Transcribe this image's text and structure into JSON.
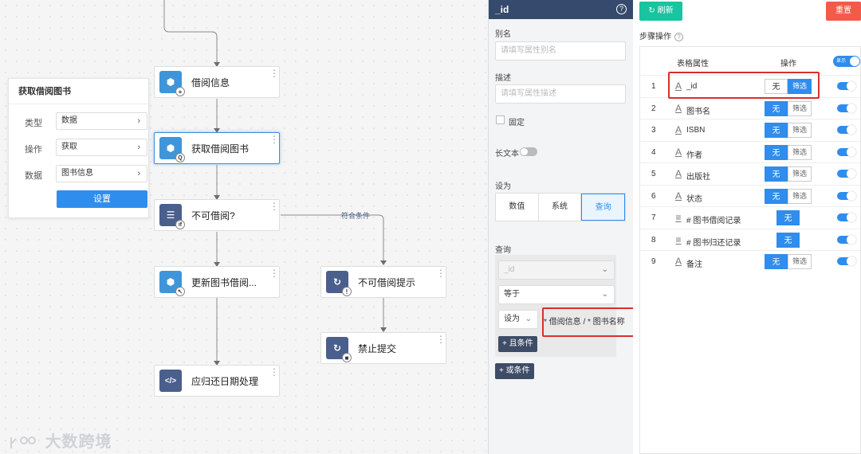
{
  "canvas": {
    "nodes": [
      {
        "label": "借阅信息",
        "icon": "cube-add-icon",
        "badge": "+"
      },
      {
        "label": "获取借阅图书",
        "icon": "cube-search-icon",
        "badge": "🔍"
      },
      {
        "label": "不可借阅?",
        "icon": "condition-if-icon",
        "badge": "if"
      },
      {
        "label": "更新图书借阅...",
        "icon": "cube-update-icon",
        "badge": "↖"
      },
      {
        "label": "不可借阅提示",
        "icon": "loop-alert-icon",
        "badge": "!"
      },
      {
        "label": "禁止提交",
        "icon": "loop-stop-icon",
        "badge": "■"
      },
      {
        "label": "应归还日期处理",
        "icon": "code-icon",
        "badge": "</>"
      }
    ],
    "condition_label": "符合条件"
  },
  "config_card": {
    "title": "获取借阅图书",
    "rows": [
      {
        "label": "类型",
        "value": "数据"
      },
      {
        "label": "操作",
        "value": "获取"
      },
      {
        "label": "数据",
        "value": "图书信息"
      }
    ],
    "button": "设置"
  },
  "watermark": "大数跨境",
  "props": {
    "title": "_id",
    "alias_label": "别名",
    "alias_placeholder": "请填写属性别名",
    "desc_label": "描述",
    "desc_placeholder": "请填写属性描述",
    "fixed_label": "固定",
    "longtext_label": "长文本",
    "setas_label": "设为",
    "setas_options": [
      "数值",
      "系统",
      "查询"
    ],
    "setas_selected": "查询",
    "query_label": "查询",
    "query_field": "_id",
    "query_op": "等于",
    "query_setas": "设为",
    "query_value": "* 借阅信息 / * 图书名称",
    "and_btn": "+ 且条件",
    "or_btn": "+ 或条件"
  },
  "right": {
    "refresh": "↻ 刷新",
    "reset": "重置",
    "steps_label": "步骤操作",
    "col_attr": "表格属性",
    "col_op": "操作",
    "show_toggle": "显示",
    "btn_none": "无",
    "btn_filter": "筛选",
    "rows": [
      {
        "num": "1",
        "type": "A",
        "name": "_id",
        "mode": "filter"
      },
      {
        "num": "2",
        "type": "A",
        "name": "图书名",
        "mode": "none"
      },
      {
        "num": "3",
        "type": "A",
        "name": "ISBN",
        "mode": "none"
      },
      {
        "num": "4",
        "type": "A",
        "name": "作者",
        "mode": "none"
      },
      {
        "num": "5",
        "type": "A",
        "name": "出版社",
        "mode": "none"
      },
      {
        "num": "6",
        "type": "A",
        "name": "状态",
        "mode": "none"
      },
      {
        "num": "7",
        "type": "≡",
        "name": "# 图书借阅记录",
        "mode": "solo"
      },
      {
        "num": "8",
        "type": "≡",
        "name": "# 图书归还记录",
        "mode": "solo"
      },
      {
        "num": "9",
        "type": "A",
        "name": "备注",
        "mode": "none"
      }
    ]
  },
  "colors": {
    "accent": "#2f8ded",
    "panel_header": "#354a6c",
    "refresh": "#19c4a0",
    "reset": "#f25b4a",
    "highlight": "#d9302c"
  }
}
